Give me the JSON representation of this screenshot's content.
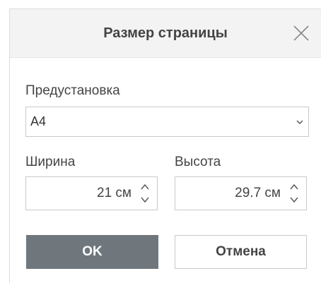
{
  "dialog": {
    "title": "Размер страницы",
    "close_icon": "close-icon"
  },
  "preset": {
    "label": "Предустановка",
    "value": "A4",
    "chevron_icon": "chevron-down-icon"
  },
  "width": {
    "label": "Ширина",
    "value": "21 см"
  },
  "height": {
    "label": "Высота",
    "value": "29.7 см"
  },
  "buttons": {
    "ok": "OK",
    "cancel": "Отмена"
  },
  "colors": {
    "header_bg": "#f3f3f3",
    "ok_bg": "#6f777d",
    "border": "#c9c9c9"
  }
}
